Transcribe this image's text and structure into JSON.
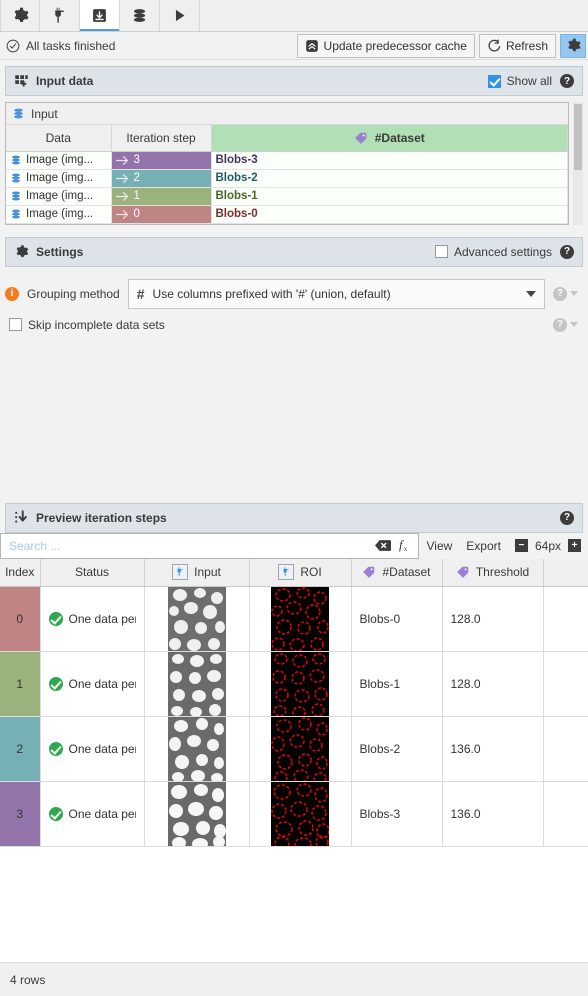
{
  "tabs": [
    {
      "icon": "gear-icon",
      "name": "tab-settings",
      "active": false
    },
    {
      "icon": "plug-icon",
      "name": "tab-connections",
      "active": false
    },
    {
      "icon": "box-download-icon",
      "name": "tab-input-data",
      "active": true
    },
    {
      "icon": "database-stack-icon",
      "name": "tab-data",
      "active": false
    },
    {
      "icon": "play-icon",
      "name": "tab-run",
      "active": false
    }
  ],
  "statusbar": {
    "status_text": "All tasks finished",
    "status_icon": "check-circle-icon",
    "update_cache_label": "Update predecessor cache",
    "refresh_label": "Refresh",
    "gear_label": ""
  },
  "input_data": {
    "title": "Input data",
    "show_all_label": "Show all",
    "show_all_checked": true,
    "inner_title": "Input",
    "columns": [
      "Data",
      "Iteration step",
      "#Dataset"
    ],
    "rows": [
      {
        "data": "Image (img...",
        "step": "3",
        "dataset": "Blobs-3",
        "color": "#9274ab",
        "text_color": "#4b2f63"
      },
      {
        "data": "Image (img...",
        "step": "2",
        "dataset": "Blobs-2",
        "color": "#76b0b5",
        "text_color": "#1d5c61"
      },
      {
        "data": "Image (img...",
        "step": "1",
        "dataset": "Blobs-1",
        "color": "#9ab37c",
        "text_color": "#4e6327"
      },
      {
        "data": "Image (img...",
        "step": "0",
        "dataset": "Blobs-0",
        "color": "#bf8484",
        "text_color": "#7d2c2c"
      }
    ]
  },
  "settings": {
    "title": "Settings",
    "advanced_label": "Advanced settings",
    "advanced_checked": false,
    "grouping_label": "Grouping method",
    "grouping_value": "Use columns prefixed with '#' (union, default)",
    "skip_label": "Skip incomplete data sets",
    "skip_checked": false
  },
  "preview": {
    "title": "Preview iteration steps",
    "search_placeholder": "Search ...",
    "search_value": "",
    "view_label": "View",
    "export_label": "Export",
    "zoom_minus": "–",
    "zoom_value": "64px",
    "zoom_plus": "+",
    "columns": [
      {
        "label": "Index",
        "icon": ""
      },
      {
        "label": "Status",
        "icon": ""
      },
      {
        "label": "Input",
        "icon": "plug-icon"
      },
      {
        "label": "ROI",
        "icon": "plug-icon"
      },
      {
        "label": "#Dataset",
        "icon": "tag-icon"
      },
      {
        "label": "Threshold",
        "icon": "tag-icon"
      }
    ],
    "rows": [
      {
        "index": "0",
        "status": "One data per...",
        "dataset": "Blobs-0",
        "threshold": "128.0",
        "color": "#bf8484"
      },
      {
        "index": "1",
        "status": "One data per...",
        "dataset": "Blobs-1",
        "threshold": "128.0",
        "color": "#9ab37c"
      },
      {
        "index": "2",
        "status": "One data per...",
        "dataset": "Blobs-2",
        "threshold": "136.0",
        "color": "#76b0b5"
      },
      {
        "index": "3",
        "status": "One data per...",
        "dataset": "Blobs-3",
        "threshold": "136.0",
        "color": "#9274ab"
      }
    ],
    "row_count_label": "4 rows"
  },
  "colors": {
    "accent_blue": "#2f93e8",
    "header_panel": "#dde3e9",
    "dataset_header_green": "#b2e0b6",
    "tag_purple": "#9b7fd4",
    "ok_green": "#2fa84f",
    "info_orange": "#f47b20"
  }
}
